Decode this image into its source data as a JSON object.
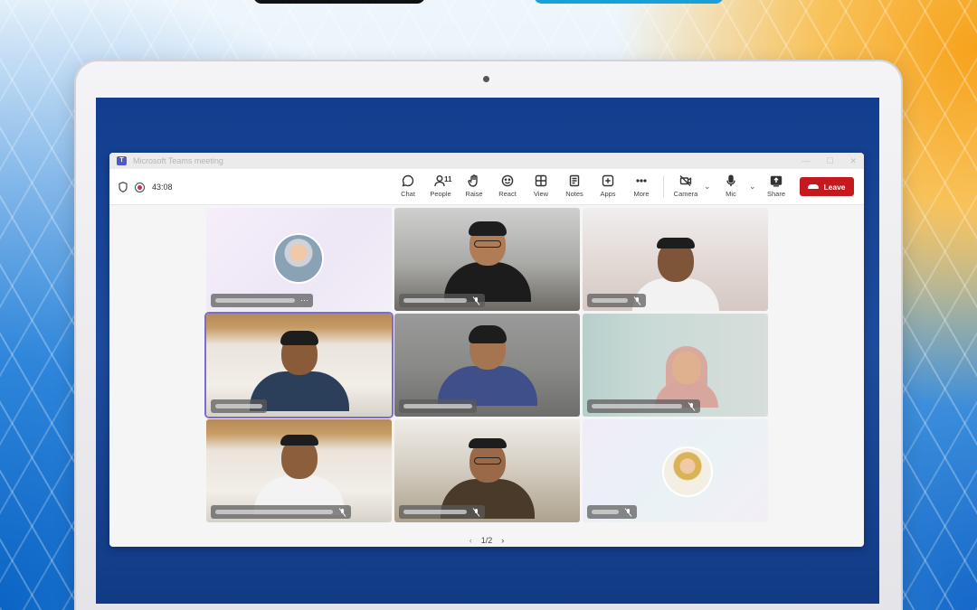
{
  "window": {
    "title": "Microsoft Teams meeting"
  },
  "toolbar": {
    "timer": "43:08",
    "buttons": [
      {
        "label": "Chat",
        "icon": "chat-icon"
      },
      {
        "label": "People",
        "icon": "people-icon",
        "badge": "11"
      },
      {
        "label": "Raise",
        "icon": "raise-hand-icon"
      },
      {
        "label": "React",
        "icon": "react-icon"
      },
      {
        "label": "View",
        "icon": "view-icon"
      },
      {
        "label": "Notes",
        "icon": "notes-icon"
      },
      {
        "label": "Apps",
        "icon": "apps-icon"
      },
      {
        "label": "More",
        "icon": "more-icon"
      },
      {
        "label": "Camera",
        "icon": "camera-off-icon"
      },
      {
        "label": "Mic",
        "icon": "mic-icon"
      },
      {
        "label": "Share",
        "icon": "share-icon"
      }
    ],
    "leave_label": "Leave",
    "leave_color": "#c4191f"
  },
  "pager": {
    "text": "1/2"
  },
  "accent_color": "#7b6bd6"
}
